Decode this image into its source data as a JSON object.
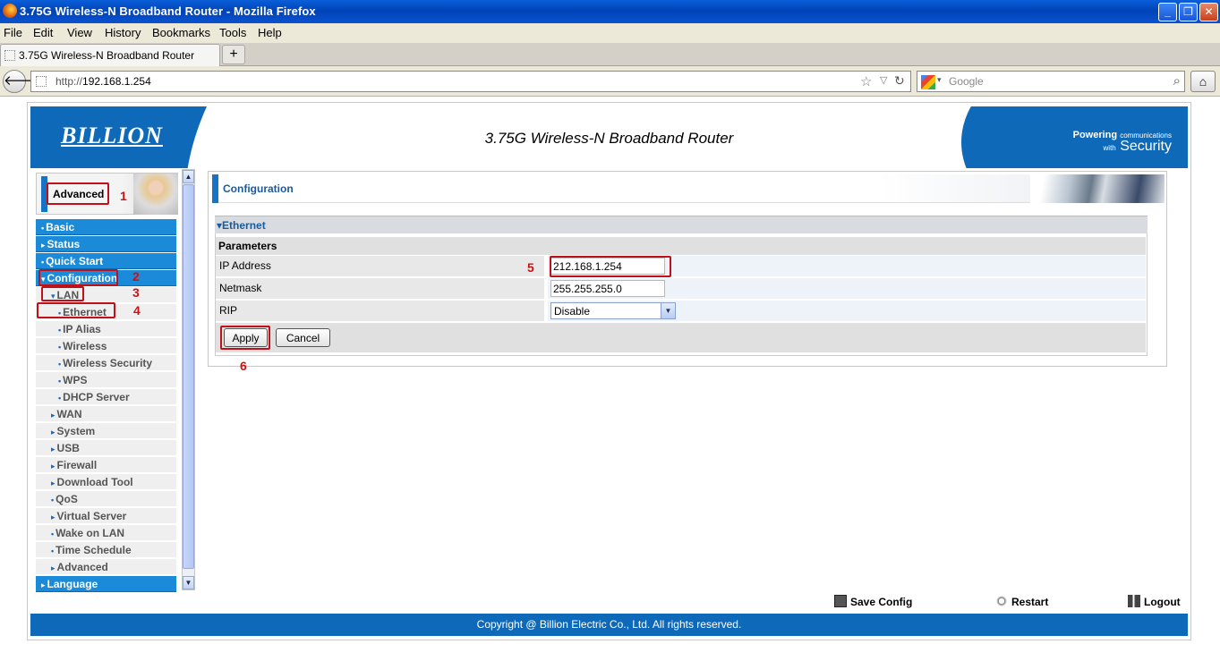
{
  "window": {
    "title": "3.75G Wireless-N Broadband Router - Mozilla Firefox",
    "min_glyph": "_",
    "max_glyph": "❐",
    "close_glyph": "✕"
  },
  "menu": [
    "File",
    "Edit",
    "View",
    "History",
    "Bookmarks",
    "Tools",
    "Help"
  ],
  "tab": {
    "label": "3.75G Wireless-N Broadband Router",
    "new_tab_glyph": "+"
  },
  "address": {
    "prefix": "http://",
    "host": "192.168.1.254"
  },
  "search": {
    "placeholder": "Google"
  },
  "icons": {
    "back": "back-arrow-icon",
    "star": "bookmark-star-icon",
    "reload": "reload-icon",
    "search": "magnifier-icon",
    "home": "home-icon",
    "save": "floppy-icon",
    "restart": "restart-icon",
    "logout": "logout-icon"
  },
  "glyphs": {
    "back": "🡐",
    "star": "☆",
    "drop": "▽",
    "reload": "↻",
    "mag": "⌕",
    "home": "⌂"
  },
  "banner": {
    "logo": "BILLION",
    "title": "3.75G Wireless-N Broadband Router",
    "tagline_1": "Powering",
    "tagline_1_small": "communications",
    "tagline_2_small": "with",
    "tagline_2": "Security"
  },
  "sidebar": {
    "header": "Advanced",
    "items": [
      {
        "label": "Basic",
        "level": "top",
        "marker": "•"
      },
      {
        "label": "Status",
        "level": "top",
        "marker": "▸"
      },
      {
        "label": "Quick Start",
        "level": "top",
        "marker": "•"
      },
      {
        "label": "Configuration",
        "level": "top",
        "marker": "▾"
      },
      {
        "label": "LAN",
        "level": "sub",
        "marker": "▾"
      },
      {
        "label": "Ethernet",
        "level": "subsub",
        "marker": "•"
      },
      {
        "label": "IP Alias",
        "level": "subsub",
        "marker": "•"
      },
      {
        "label": "Wireless",
        "level": "subsub",
        "marker": "•"
      },
      {
        "label": "Wireless Security",
        "level": "subsub",
        "marker": "•"
      },
      {
        "label": "WPS",
        "level": "subsub",
        "marker": "•"
      },
      {
        "label": "DHCP Server",
        "level": "subsub",
        "marker": "•"
      },
      {
        "label": "WAN",
        "level": "sub",
        "marker": "▸"
      },
      {
        "label": "System",
        "level": "sub",
        "marker": "▸"
      },
      {
        "label": "USB",
        "level": "sub",
        "marker": "▸"
      },
      {
        "label": "Firewall",
        "level": "sub",
        "marker": "▸"
      },
      {
        "label": "Download Tool",
        "level": "sub",
        "marker": "▸"
      },
      {
        "label": "QoS",
        "level": "sub",
        "marker": "•"
      },
      {
        "label": "Virtual Server",
        "level": "sub",
        "marker": "▸"
      },
      {
        "label": "Wake on LAN",
        "level": "sub",
        "marker": "•"
      },
      {
        "label": "Time Schedule",
        "level": "sub",
        "marker": "•"
      },
      {
        "label": "Advanced",
        "level": "sub",
        "marker": "▸"
      },
      {
        "label": "Language",
        "level": "top",
        "marker": "▸"
      }
    ]
  },
  "main": {
    "section_title": "Configuration",
    "subsection": "▾Ethernet",
    "params_heading": "Parameters",
    "ip_label": "IP Address",
    "ip_value": "212.168.1.254",
    "netmask_label": "Netmask",
    "netmask_value": "255.255.255.0",
    "rip_label": "RIP",
    "rip_value": "Disable",
    "apply": "Apply",
    "cancel": "Cancel"
  },
  "annotations": [
    "1",
    "2",
    "3",
    "4",
    "5",
    "6"
  ],
  "colors": {
    "accent_red": "#c0101a",
    "nav_blue": "#1b8ad8",
    "banner_blue": "#0e6ab8"
  },
  "bottom": {
    "save": "Save Config",
    "restart": "Restart",
    "logout": "Logout",
    "copyright": "Copyright @ Billion Electric Co., Ltd. All rights reserved."
  }
}
